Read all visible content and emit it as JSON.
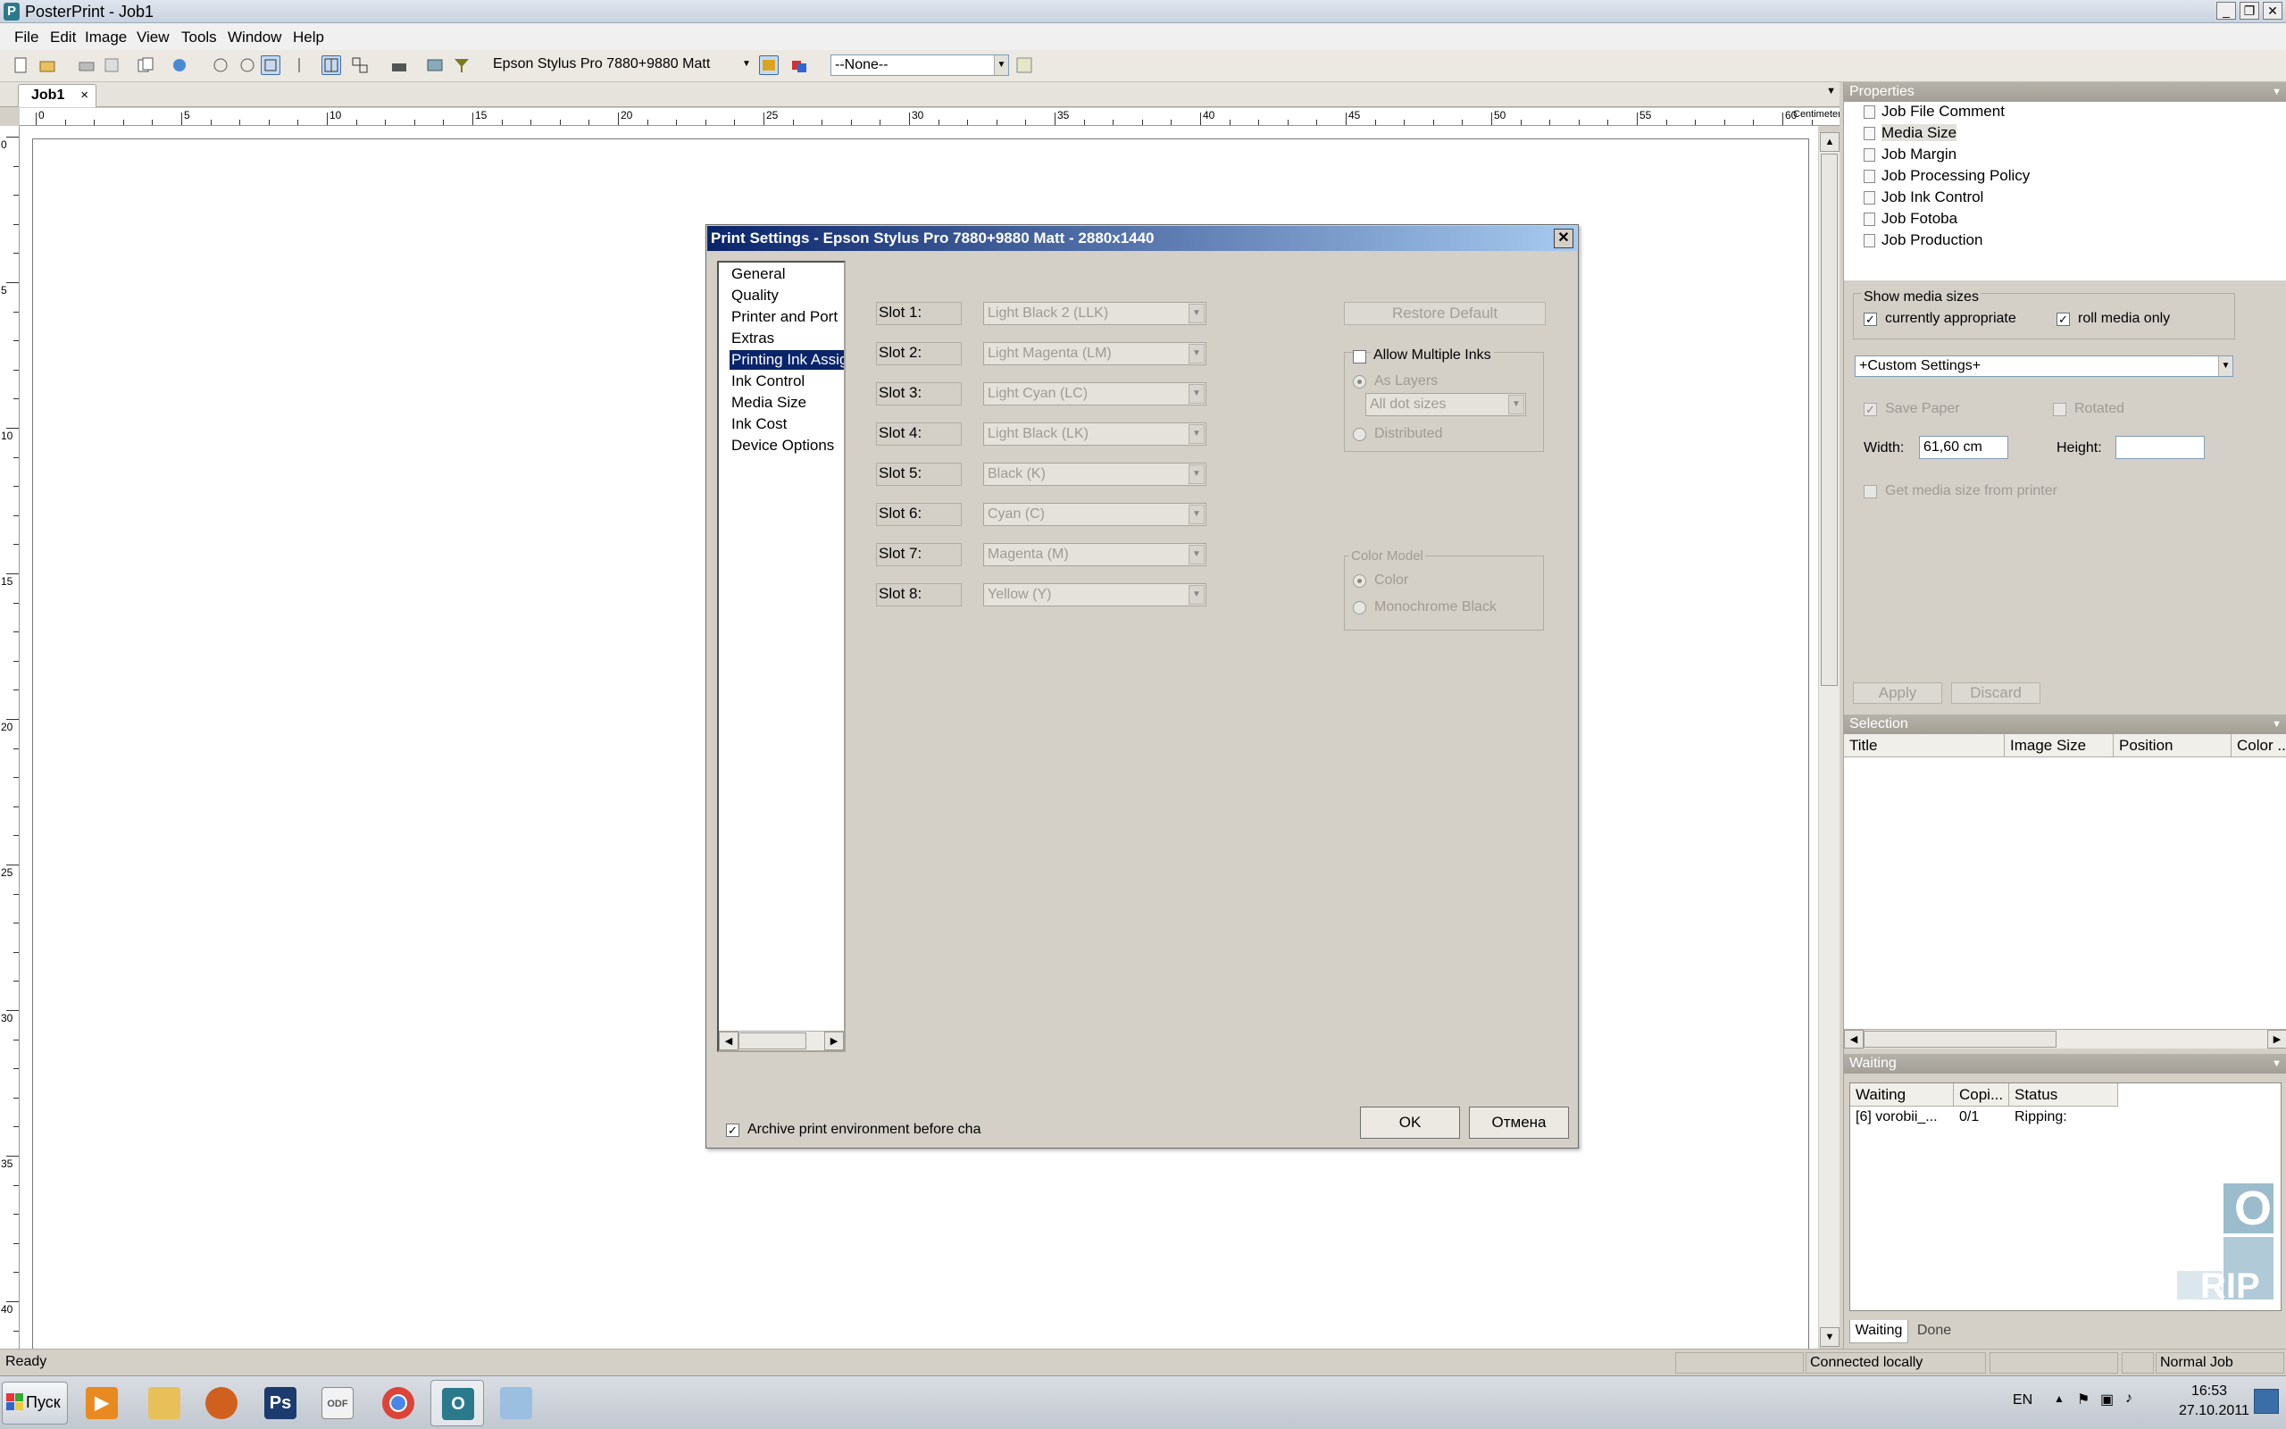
{
  "window": {
    "title": "PosterPrint - Job1"
  },
  "menu": [
    "File",
    "Edit",
    "Image",
    "View",
    "Tools",
    "Window",
    "Help"
  ],
  "toolbar": {
    "printer": "Epson Stylus Pro  7880+9880 Matt",
    "profile": "--None--"
  },
  "tabs": [
    {
      "label": "Job1",
      "close": "×"
    }
  ],
  "ruler": {
    "h_labels": [
      "0",
      "5",
      "10",
      "15",
      "20",
      "25",
      "30",
      "35",
      "40",
      "45",
      "50",
      "55",
      "60"
    ],
    "unit": "Centimeter",
    "v_labels": [
      "0",
      "5",
      "10",
      "15",
      "20",
      "25",
      "30",
      "35",
      "40"
    ]
  },
  "properties": {
    "title": "Properties",
    "tree": [
      "Job File Comment",
      "Media Size",
      "Job Margin",
      "Job Processing Policy",
      "Job Ink Control",
      "Job Fotoba",
      "Job Production"
    ],
    "show_media_sizes": "Show media sizes",
    "currently_appropriate": "currently appropriate",
    "roll_media_only": "roll media only",
    "custom_settings": "+Custom Settings+",
    "save_paper": "Save Paper",
    "rotated": "Rotated",
    "width_label": "Width:",
    "width_value": "61,60 cm",
    "height_label": "Height:",
    "height_value": "",
    "get_media_size": "Get media size from printer",
    "apply": "Apply",
    "discard": "Discard"
  },
  "selection": {
    "title": "Selection",
    "columns": [
      "Title",
      "Image Size",
      "Position",
      "Color ..."
    ]
  },
  "waiting": {
    "title": "Waiting",
    "columns": [
      "Waiting",
      "Copi...",
      "Status"
    ],
    "rows": [
      {
        "name": "[6]  vorobii_...",
        "copies": "0/1",
        "status": "Ripping:"
      }
    ],
    "tabs": [
      "Waiting",
      "Done"
    ]
  },
  "statusbar": {
    "ready": "Ready",
    "connection": "Connected locally",
    "mode": "Normal Job"
  },
  "taskbar": {
    "start": "Пуск",
    "lang": "EN",
    "time": "16:53",
    "date": "27.10.2011"
  },
  "dialog": {
    "title": "Print Settings - Epson Stylus Pro  7880+9880 Matt - 2880x1440",
    "close": "✕",
    "nav": [
      "General",
      "Quality",
      "Printer and Port",
      "Extras",
      "Printing Ink Assig",
      "Ink Control",
      "Media Size",
      "Ink Cost",
      "Device Options"
    ],
    "slots": [
      {
        "label": "Slot 1:",
        "value": "Light Black 2 (LLK)"
      },
      {
        "label": "Slot 2:",
        "value": "Light Magenta (LM)"
      },
      {
        "label": "Slot 3:",
        "value": "Light Cyan (LC)"
      },
      {
        "label": "Slot 4:",
        "value": "Light Black (LK)"
      },
      {
        "label": "Slot 5:",
        "value": "Black (K)"
      },
      {
        "label": "Slot 6:",
        "value": "Cyan (C)"
      },
      {
        "label": "Slot 7:",
        "value": "Magenta (M)"
      },
      {
        "label": "Slot 8:",
        "value": "Yellow (Y)"
      }
    ],
    "restore_default": "Restore Default",
    "allow_multiple_inks": "Allow Multiple Inks",
    "as_layers": "As Layers",
    "dot_sizes": "All dot sizes",
    "distributed": "Distributed",
    "color_model": "Color Model",
    "color": "Color",
    "monochrome_black": "Monochrome Black",
    "archive": "Archive print environment before cha",
    "ok": "OK",
    "cancel": "Отмена"
  }
}
